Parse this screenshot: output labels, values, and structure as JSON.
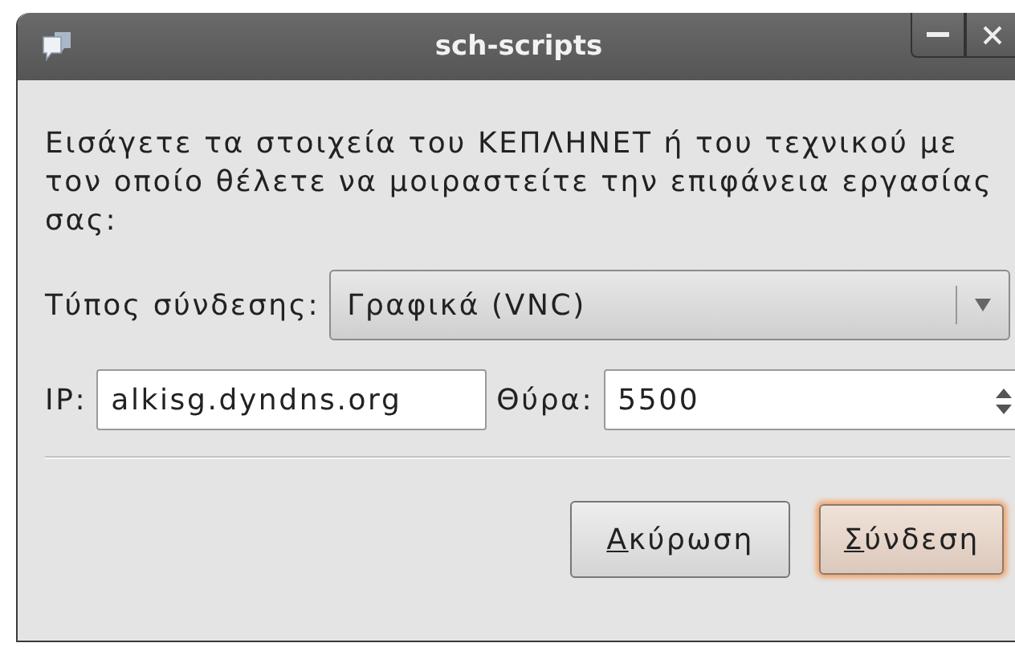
{
  "window": {
    "title": "sch-scripts"
  },
  "message": "Εισάγετε τα στοιχεία του ΚΕΠΛΗΝΕΤ ή του τεχνικού με τον οποίο θέλετε να μοιραστείτε την επιφάνεια εργασίας σας:",
  "connection_type": {
    "label": "Τύπος σύνδεσης:",
    "value": "Γραφικά (VNC)"
  },
  "ip": {
    "label": "IP:",
    "value": "alkisg.dyndns.org"
  },
  "port": {
    "label": "Θύρα:",
    "value": "5500"
  },
  "buttons": [
    {
      "label": "Ακύρωση",
      "default": false
    },
    {
      "label": "Σύνδεση",
      "default": true
    }
  ]
}
